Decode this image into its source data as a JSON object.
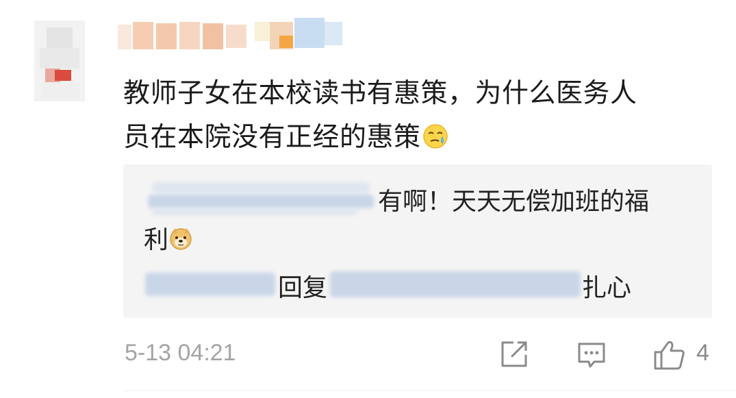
{
  "comment": {
    "username": "",
    "text_line1": "教师子女在本校读书有惠策，为什么医务人",
    "text_line2": "员在本院没有正经的惠策",
    "emoji": "sweat-smile-emoji"
  },
  "replies": [
    {
      "author": "",
      "text_line1": "有啊！天天无偿加班的福",
      "text_line2": "利",
      "emoji": "doge-emoji"
    },
    {
      "author": "",
      "reply_word": "回复",
      "reply_to": "",
      "text": "扎心"
    }
  ],
  "footer": {
    "timestamp": "5-13 04:21",
    "like_count": "4",
    "icons": [
      "share-icon",
      "comment-icon",
      "like-icon"
    ]
  },
  "colors": {
    "reply_bg": "#f4f4f4",
    "meta_gray": "#a4a4a4",
    "icon_gray": "#8a8a8a"
  }
}
